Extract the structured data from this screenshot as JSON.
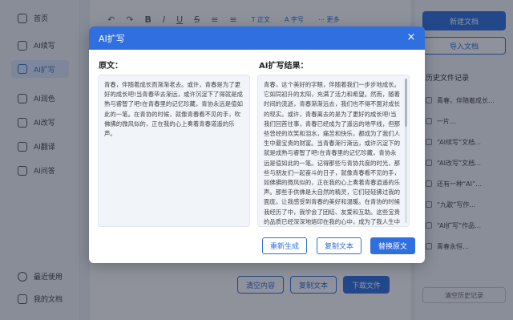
{
  "app": {
    "sidebar": [
      {
        "label": "首页",
        "icon": "home-icon"
      },
      {
        "label": "AI续写",
        "icon": "continue-icon"
      },
      {
        "label": "AI扩写",
        "icon": "expand-icon",
        "active": true
      },
      {
        "label": "AI润色",
        "icon": "polish-icon"
      },
      {
        "label": "AI改写",
        "icon": "rewrite-icon"
      },
      {
        "label": "AI翻译",
        "icon": "translate-icon"
      },
      {
        "label": "AI问答",
        "icon": "qa-icon"
      }
    ],
    "sidebar_bottom": [
      {
        "label": "最近使用",
        "icon": "clock-icon"
      },
      {
        "label": "我的文档",
        "icon": "doc-icon"
      }
    ],
    "toolbar": {
      "undo": "↶",
      "redo": "↷",
      "bold": "B",
      "italic": "I",
      "underline": "U",
      "strike": "S",
      "align_left": "≡",
      "align_right": "≡",
      "style_select": "T 正文",
      "font_size": "A 字号",
      "more": "⋯ 更多"
    },
    "bottom_buttons": [
      "清空内容",
      "复制文本",
      "下载文件"
    ],
    "right_panel": {
      "new_doc": "新建文档",
      "import_doc": "导入文档",
      "history_title": "历史文件记录",
      "history": [
        "青春，伴随着成长…",
        "一片…",
        "“AI续写”文档…",
        "“AI改写”文档…",
        "还有一种“AI”…",
        "“九歌”写作…",
        "“AI扩写”作品…",
        "青春永恒…"
      ],
      "clear_history": "清空历史记录"
    }
  },
  "modal": {
    "title": "AI扩写",
    "close": "×",
    "original_label": "原文：",
    "result_label": "AI扩写结果：",
    "original_text": "青春，伴随着成长而渐渐老去。或许，青春是为了更好的成长吧!当青春毕去渐远，或许沉淀下了得就是成熟与睿智了吧!在青春里的记忆珍藏，青协永远是值如此的一笔。在青协的时候，就像青春看不见的手，吹佛拂的微风似的，正在我的心上奏着青春道遥的乐声。",
    "result_text": "青春，这个美好的字眼，伴随着我们一步步地成长。它如同初升的太阳，充满了活力和希望。然而，随着时间的流逝，青春渐渐远去，我们也不得不面对成长的现实。或许，青春离去的是为了更好的成长吧!当我们回首往事，青春已经成为了遥远的地平线，但那些曾经的欢笑和泪水，痛苦和快乐，都成为了我们人生中最宝贵的财富。当青春渐行渐远，或许沉淀下的就是成熟与睿智了吧!在青春里的记忆珍藏，青协永远是值如此的一笔。记得那些与青协共度的时光，那些与朋友们一起奋斗的日子，就像青春看不见的手，如佛拂的微风似的，正在我的心上奏着青春逍遥的乐声。那些手供佛是大自然的精灵，它们轻轻拂过我的面庞，让我感受到青春的美好和温暖。在青协的时候我经历了中，我学会了团结、友爱和互助。这些宝贵的品质已经深深地烙印在我的心中，成为了我人生中不可或缺的一部分。",
    "buttons": {
      "regenerate": "重新生成",
      "copy": "复制文本",
      "replace": "替换原文"
    }
  }
}
